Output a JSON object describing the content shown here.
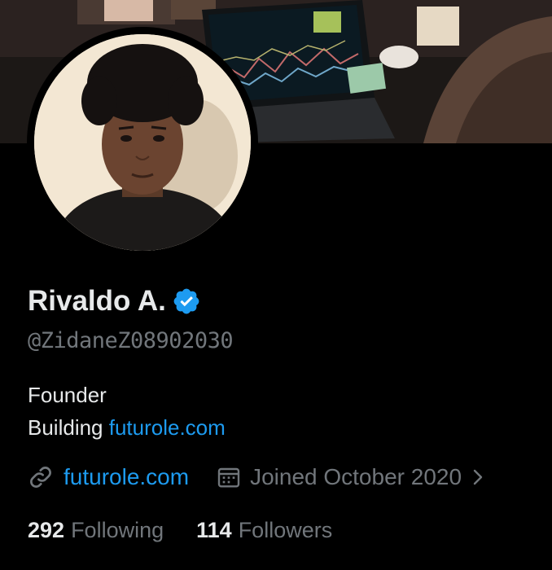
{
  "profile": {
    "name": "Rivaldo A.",
    "handle": "@ZidaneZ08902030",
    "bio_line1": "Founder",
    "bio_prefix": "Building ",
    "bio_link": "futurole.com",
    "website": "futurole.com",
    "joined": "Joined October 2020",
    "following_count": "292",
    "following_label": "Following",
    "followers_count": "114",
    "followers_label": "Followers"
  },
  "icons": {
    "verified": "verified-badge-icon",
    "link": "link-icon",
    "calendar": "calendar-icon",
    "chevron": "chevron-right-icon"
  },
  "colors": {
    "background": "#000000",
    "accent": "#1d9bf0",
    "text_primary": "#e7e9ea",
    "text_secondary": "#71767b"
  }
}
